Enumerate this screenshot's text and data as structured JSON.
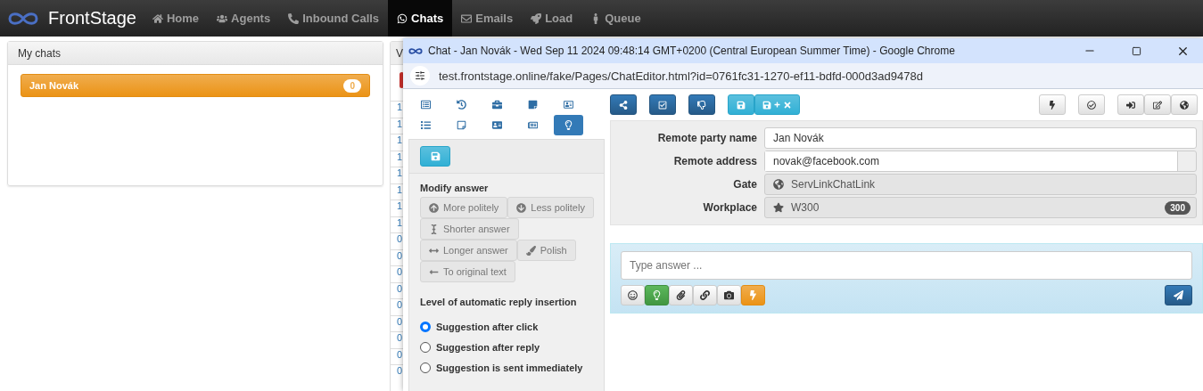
{
  "navbar": {
    "brand": "FrontStage",
    "items": [
      {
        "label": "Home",
        "selected": false
      },
      {
        "label": "Agents",
        "selected": false
      },
      {
        "label": "Inbound Calls",
        "selected": false
      },
      {
        "label": "Chats",
        "selected": true
      },
      {
        "label": "Emails",
        "selected": false
      },
      {
        "label": "Load",
        "selected": false
      },
      {
        "label": "Queue",
        "selected": false
      }
    ]
  },
  "my_chats": {
    "title": "My chats",
    "items": [
      {
        "name": "Jan Novák",
        "count": "0",
        "selected": true
      }
    ]
  },
  "background_panel": {
    "title": "V",
    "column_1": [
      "1",
      "1",
      "1",
      "1",
      "1",
      "1",
      "1",
      "1",
      "0",
      "0",
      "0",
      "0",
      "0",
      "0",
      "0",
      "0",
      "0"
    ]
  },
  "popup": {
    "title": "Chat - Jan Novák - Wed Sep 11 2024 09:48:14 GMT+0200 (Central European Summer Time) - Google Chrome",
    "url": "test.frontstage.online/fake/Pages/ChatEditor.html?id=0761fc31-1270-ef11-bdfd-000d3ad9478d",
    "editor_tabs": [
      {
        "selected": false
      },
      {
        "selected": false
      },
      {
        "selected": false
      },
      {
        "selected": false
      },
      {
        "selected": false
      },
      {
        "selected": false
      },
      {
        "selected": false
      },
      {
        "selected": false
      },
      {
        "selected": false
      },
      {
        "selected": true
      }
    ],
    "modify_answer": {
      "title": "Modify answer",
      "buttons": [
        {
          "label": "More politely"
        },
        {
          "label": "Less politely"
        },
        {
          "label": "Shorter answer"
        },
        {
          "label": "Longer answer"
        },
        {
          "label": "Polish"
        },
        {
          "label": "To original text"
        }
      ]
    },
    "insertion_level": {
      "title": "Level of automatic reply insertion",
      "options": [
        {
          "label": "Suggestion after click",
          "selected": true
        },
        {
          "label": "Suggestion after reply",
          "selected": false
        },
        {
          "label": "Suggestion is sent immediately",
          "selected": false
        }
      ]
    },
    "fields": [
      {
        "label": "Remote party name",
        "value": "Jan Novák",
        "kind": "input"
      },
      {
        "label": "Remote address",
        "value": "novak@facebook.com",
        "kind": "input-addon"
      },
      {
        "label": "Gate",
        "value": "ServLinkChatLink",
        "kind": "readonly"
      },
      {
        "label": "Workplace",
        "value": "W300",
        "kind": "readonly",
        "badge": "300"
      }
    ],
    "composer": {
      "placeholder": "Type answer ...",
      "buttons": [
        {
          "kind": "default"
        },
        {
          "kind": "success"
        },
        {
          "kind": "default"
        },
        {
          "kind": "default"
        },
        {
          "kind": "default"
        },
        {
          "kind": "warning"
        }
      ]
    }
  }
}
